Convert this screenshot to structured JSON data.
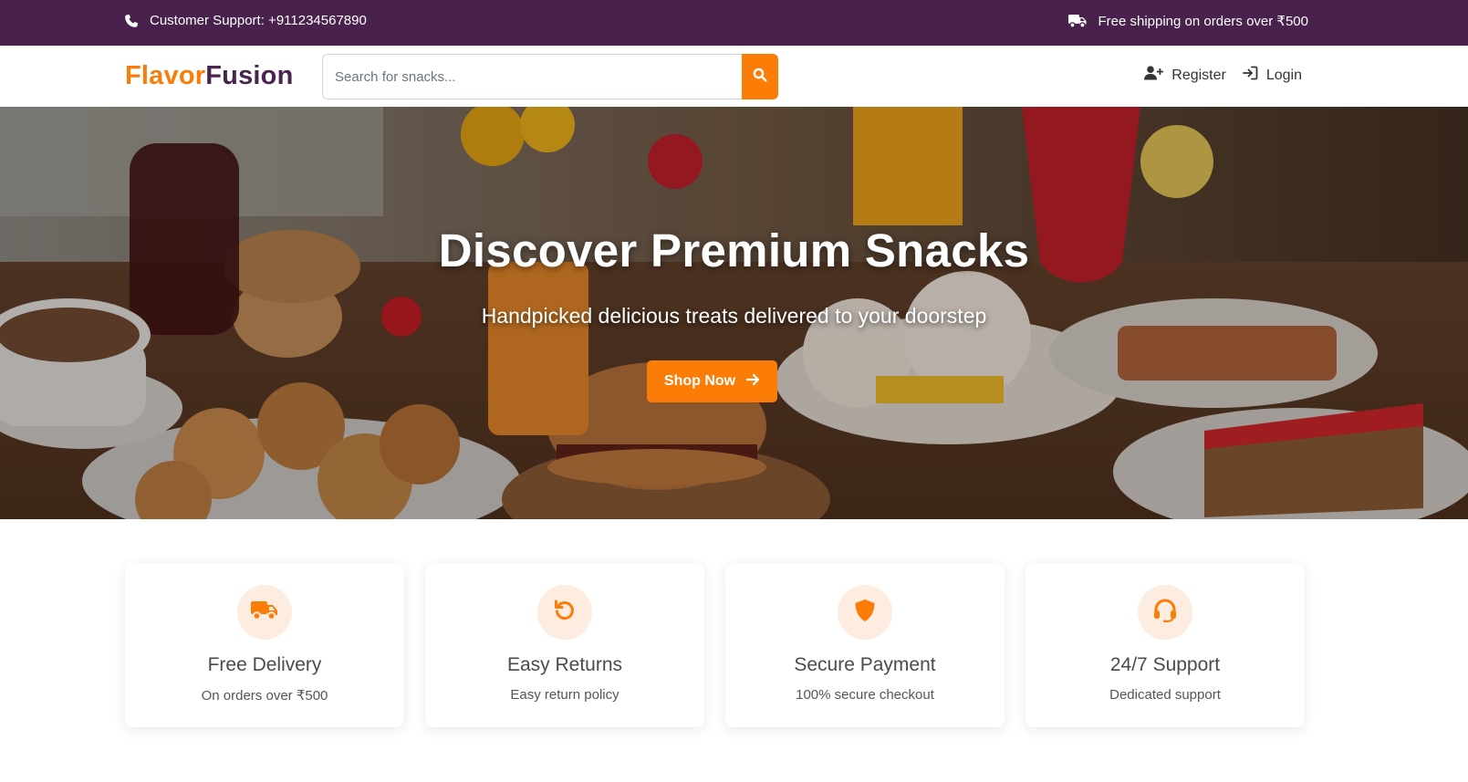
{
  "topbar": {
    "support": "Customer Support: +911234567890",
    "shipping": "Free shipping on orders over ₹500",
    "support_icon": "phone-icon",
    "shipping_icon": "truck-icon"
  },
  "header": {
    "logo_part1": "Flavor",
    "logo_part2": "Fusion",
    "search_placeholder": "Search for snacks...",
    "search_icon": "search-icon",
    "register_label": "Register",
    "login_label": "Login"
  },
  "hero": {
    "title": "Discover Premium Snacks",
    "subtitle": "Handpicked delicious treats delivered to your doorstep",
    "cta_label": "Shop Now"
  },
  "features": [
    {
      "icon": "truck-icon",
      "title": "Free Delivery",
      "desc": "On orders over ₹500"
    },
    {
      "icon": "undo-icon",
      "title": "Easy Returns",
      "desc": "Easy return policy"
    },
    {
      "icon": "shield-icon",
      "title": "Secure Payment",
      "desc": "100% secure checkout"
    },
    {
      "icon": "headset-icon",
      "title": "24/7 Support",
      "desc": "Dedicated support"
    }
  ],
  "colors": {
    "topbar_bg": "#48224c",
    "accent": "#fb7d08",
    "logo_dark": "#4a2350",
    "icon_circle_bg": "#fdece0"
  }
}
